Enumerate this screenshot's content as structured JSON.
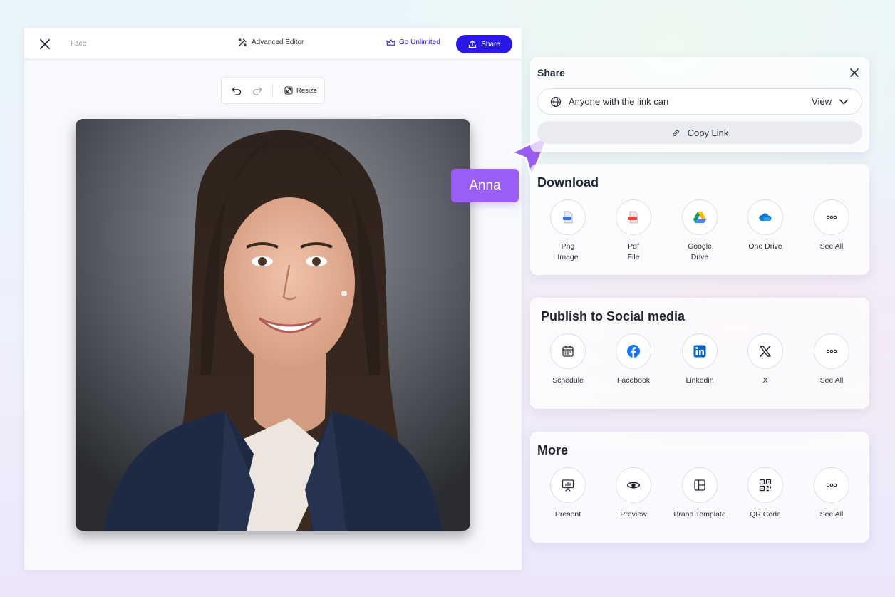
{
  "editor": {
    "doc_name": "Face",
    "advanced_editor": "Advanced Editor",
    "go_unlimited": "Go Unlimited",
    "share": "Share",
    "resize": "Resize"
  },
  "collaborator": {
    "name": "Anna",
    "color": "#9b5ef5"
  },
  "share_panel": {
    "title": "Share",
    "link_access": "Anyone with the link can",
    "permission": "View",
    "copy_link": "Copy Link"
  },
  "download": {
    "title": "Download",
    "items": [
      {
        "label": "Png\nImage",
        "icon": "png-file-icon"
      },
      {
        "label": "Pdf\nFile",
        "icon": "pdf-file-icon"
      },
      {
        "label": "Google\nDrive",
        "icon": "google-drive-icon"
      },
      {
        "label": "One Drive",
        "icon": "onedrive-icon"
      },
      {
        "label": "See All",
        "icon": "more-icon"
      }
    ]
  },
  "social": {
    "title": "Publish to Social media",
    "items": [
      {
        "label": "Schedule",
        "icon": "calendar-icon"
      },
      {
        "label": "Facebook",
        "icon": "facebook-icon"
      },
      {
        "label": "Linkedin",
        "icon": "linkedin-icon"
      },
      {
        "label": "X",
        "icon": "x-icon"
      },
      {
        "label": "See All",
        "icon": "more-icon"
      }
    ]
  },
  "more": {
    "title": "More",
    "items": [
      {
        "label": "Present",
        "icon": "presentation-icon"
      },
      {
        "label": "Preview",
        "icon": "eye-icon"
      },
      {
        "label": "Brand Template",
        "icon": "layout-icon"
      },
      {
        "label": "QR Code",
        "icon": "qr-code-icon"
      },
      {
        "label": "See All",
        "icon": "more-icon"
      }
    ]
  },
  "colors": {
    "accent": "#2a18e8",
    "cursor": "#9b5ef5",
    "facebook": "#1877f2",
    "linkedin": "#0a66c2"
  }
}
